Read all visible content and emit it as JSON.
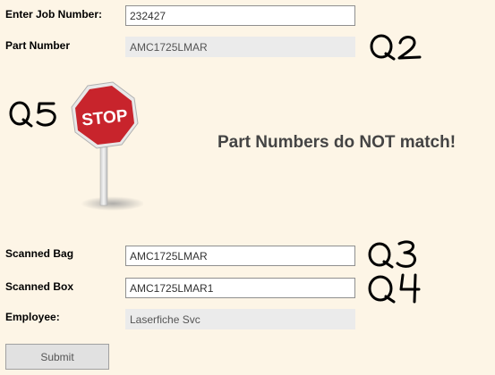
{
  "form": {
    "job_number_label": "Enter Job Number:",
    "job_number_value": "232427",
    "part_number_label": "Part Number",
    "part_number_value": "AMC1725LMAR",
    "scanned_bag_label": "Scanned Bag",
    "scanned_bag_value": "AMC1725LMAR",
    "scanned_box_label": "Scanned Box",
    "scanned_box_value": "AMC1725LMAR1",
    "employee_label": "Employee:",
    "employee_value": "Laserfiche Svc",
    "submit_label": "Submit"
  },
  "status": {
    "message": "Part Numbers do NOT match!",
    "sign_text": "STOP",
    "sign_color": "#c8242c"
  },
  "annotations": {
    "q2": "Q2",
    "q3": "Q3",
    "q4": "Q4",
    "q5": "Q5"
  }
}
